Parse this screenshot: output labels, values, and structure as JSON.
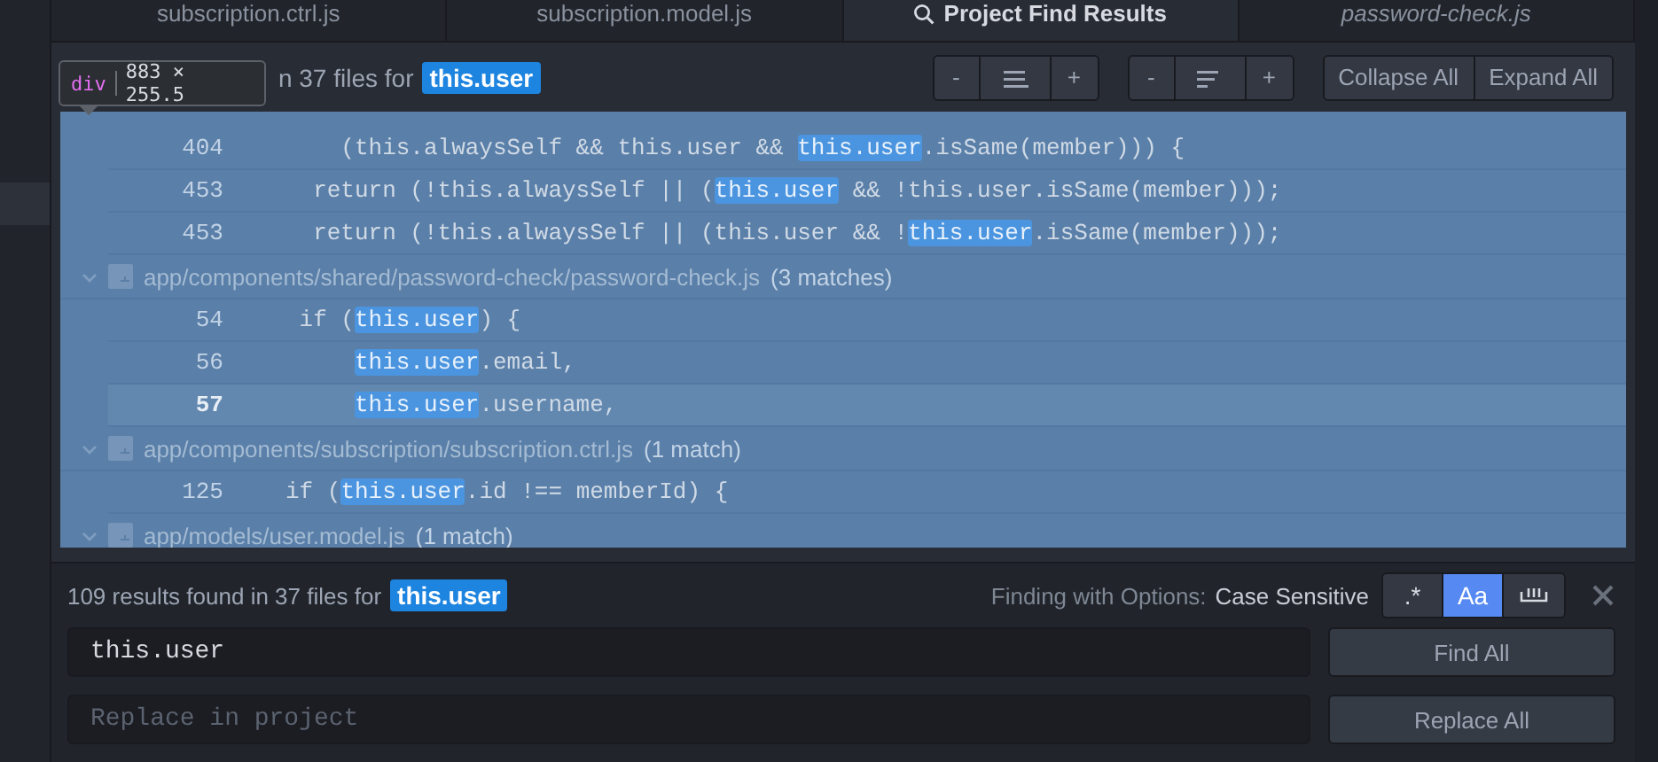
{
  "tabs": [
    {
      "label": "subscription.ctrl.js",
      "selected": false,
      "italic": false,
      "icon": false
    },
    {
      "label": "subscription.model.js",
      "selected": false,
      "italic": false,
      "icon": false
    },
    {
      "label": "Project Find Results",
      "selected": true,
      "italic": false,
      "icon": true
    },
    {
      "label": "password-check.js",
      "selected": false,
      "italic": true,
      "icon": false
    }
  ],
  "inspector_tooltip": {
    "tag": "div",
    "size": "883 × 255.5"
  },
  "results_header": {
    "text": "n 37 files for",
    "query": "this.user"
  },
  "toolbar": {
    "groups": [
      [
        {
          "kind": "text",
          "label": "-"
        },
        {
          "kind": "icon"
        },
        {
          "kind": "text",
          "label": "+"
        }
      ],
      [
        {
          "kind": "text",
          "label": "-"
        },
        {
          "kind": "icon"
        },
        {
          "kind": "text",
          "label": "+"
        }
      ],
      [
        {
          "kind": "text",
          "label": "Collapse All"
        },
        {
          "kind": "text",
          "label": "Expand All"
        }
      ]
    ]
  },
  "results": [
    {
      "kind": "match",
      "line": "404",
      "before": "    (this.alwaysSelf && this.user && ",
      "match": "this.user",
      "after": ".isSame(member))) {",
      "selected": false
    },
    {
      "kind": "match",
      "line": "453",
      "before": "  return (!this.alwaysSelf || (",
      "match": "this.user",
      "after": " && !this.user.isSame(member)));",
      "selected": false
    },
    {
      "kind": "match",
      "line": "453",
      "before": "  return (!this.alwaysSelf || (this.user && !",
      "match": "this.user",
      "after": ".isSame(member)));",
      "selected": false
    },
    {
      "kind": "file",
      "path": "app/components/shared/password-check/password-check.js",
      "count": "(3 matches)",
      "expanded": true
    },
    {
      "kind": "match",
      "line": "54",
      "before": " if (",
      "match": "this.user",
      "after": ") {",
      "selected": false
    },
    {
      "kind": "match",
      "line": "56",
      "match": "this.user",
      "after": ".email,",
      "selected": false
    },
    {
      "kind": "match",
      "line": "57",
      "match": "this.user",
      "after": ".username,",
      "selected": true
    },
    {
      "kind": "file",
      "path": "app/components/subscription/subscription.ctrl.js",
      "count": "(1 match)",
      "expanded": true
    },
    {
      "kind": "match",
      "line": "125",
      "before": "if (",
      "match": "this.user",
      "after": ".id !== memberId) {",
      "selected": false
    },
    {
      "kind": "file",
      "path": "app/models/user.model.js",
      "count": "(1 match)",
      "expanded": true
    }
  ],
  "find_panel": {
    "summary": "109 results found in 37 files for",
    "query": "this.user",
    "options_label": "Finding with Options:",
    "options_value": "Case Sensitive",
    "options": [
      {
        "kind": "text",
        "label": ".*",
        "selected": false
      },
      {
        "kind": "text",
        "label": "Aa",
        "selected": true
      },
      {
        "kind": "icon",
        "selected": false
      }
    ],
    "find_value": "this.user",
    "find_button": "Find All",
    "replace_placeholder": "Replace in project",
    "replace_button": "Replace All"
  }
}
